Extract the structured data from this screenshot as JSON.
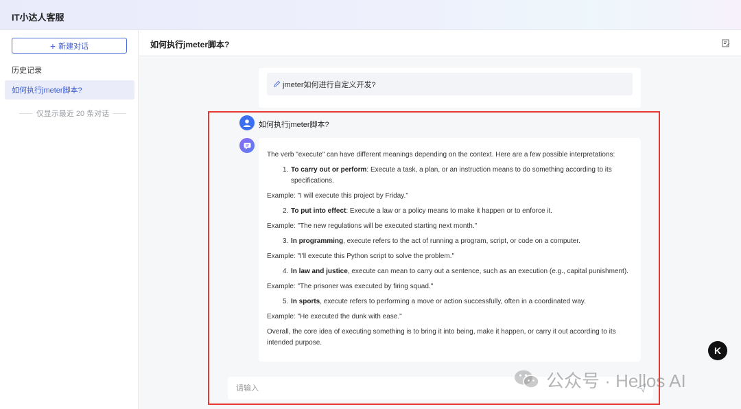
{
  "app": {
    "title": "IT小达人客服"
  },
  "sidebar": {
    "new_chat_label": "新建对话",
    "history_label": "历史记录",
    "items": [
      {
        "label": "如何执行jmeter脚本?"
      }
    ],
    "note": "仅显示最近 20 条对话"
  },
  "main": {
    "title": "如何执行jmeter脚本?",
    "previous_prompt": "jmeter如何进行自定义开发?",
    "user_question": "如何执行jmeter脚本?",
    "answer": {
      "intro": "The verb \"execute\" can have different meanings depending on the context. Here are a few possible interpretations:",
      "items": [
        {
          "num": "1.",
          "term": "To carry out or perform",
          "text": ": Execute a task, a plan, or an instruction means to do something according to its specifications.",
          "example": "Example: \"I will execute this project by Friday.\""
        },
        {
          "num": "2.",
          "term": "To put into effect",
          "text": ": Execute a law or a policy means to make it happen or to enforce it.",
          "example": "Example: \"The new regulations will be executed starting next month.\""
        },
        {
          "num": "3.",
          "term": "In programming",
          "text": ", execute refers to the act of running a program, script, or code on a computer.",
          "example": "Example: \"I'll execute this Python script to solve the problem.\""
        },
        {
          "num": "4.",
          "term": "In law and justice",
          "text": ", execute can mean to carry out a sentence, such as an execution (e.g., capital punishment).",
          "example": "Example: \"The prisoner was executed by firing squad.\""
        },
        {
          "num": "5.",
          "term": "In sports",
          "text": ", execute refers to performing a move or action successfully, often in a coordinated way.",
          "example": "Example: \"He executed the dunk with ease.\""
        }
      ],
      "conclusion": "Overall, the core idea of executing something is to bring it into being, make it happen, or carry it out according to its intended purpose."
    },
    "input": {
      "placeholder": "请输入",
      "value": ""
    }
  },
  "watermark": {
    "text": "公众号 · Hellos AI"
  },
  "floating_logo": {
    "letter": "K"
  },
  "colors": {
    "accent": "#3b5bd1",
    "highlight_frame": "#e53935",
    "user_avatar": "#3c6ef0",
    "bot_avatar": "#8c6bf2"
  },
  "icons": {
    "new_chat": "plus-icon",
    "edit": "edit-icon",
    "prompt": "pen-icon",
    "user": "user-avatar-icon",
    "bot": "bot-chat-icon",
    "send": "send-icon",
    "watermark": "wechat-icon"
  }
}
